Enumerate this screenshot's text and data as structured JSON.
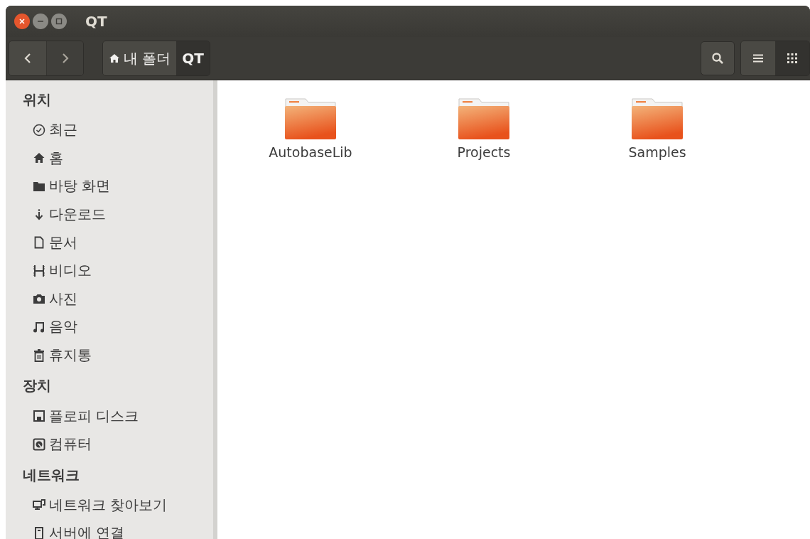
{
  "window": {
    "title": "QT"
  },
  "toolbar": {
    "breadcrumbs": [
      {
        "label": "내 폴더",
        "selected": false
      },
      {
        "label": "QT",
        "selected": true
      }
    ],
    "views": [
      {
        "kind": "list",
        "selected": false
      },
      {
        "kind": "grid",
        "selected": true
      }
    ]
  },
  "sidebar": {
    "sections": [
      {
        "title": "위치",
        "items": [
          {
            "label": "최근"
          },
          {
            "label": "홈"
          },
          {
            "label": "바탕 화면"
          },
          {
            "label": "다운로드"
          },
          {
            "label": "문서"
          },
          {
            "label": "비디오"
          },
          {
            "label": "사진"
          },
          {
            "label": "음악"
          },
          {
            "label": "휴지통"
          }
        ]
      },
      {
        "title": "장치",
        "items": [
          {
            "label": "플로피 디스크"
          },
          {
            "label": "컴퓨터"
          }
        ]
      },
      {
        "title": "네트워크",
        "items": [
          {
            "label": "네트워크 찾아보기"
          },
          {
            "label": "서버에 연결"
          }
        ]
      }
    ]
  },
  "files": [
    {
      "name": "AutobaseLib"
    },
    {
      "name": "Projects"
    },
    {
      "name": "Samples"
    }
  ]
}
